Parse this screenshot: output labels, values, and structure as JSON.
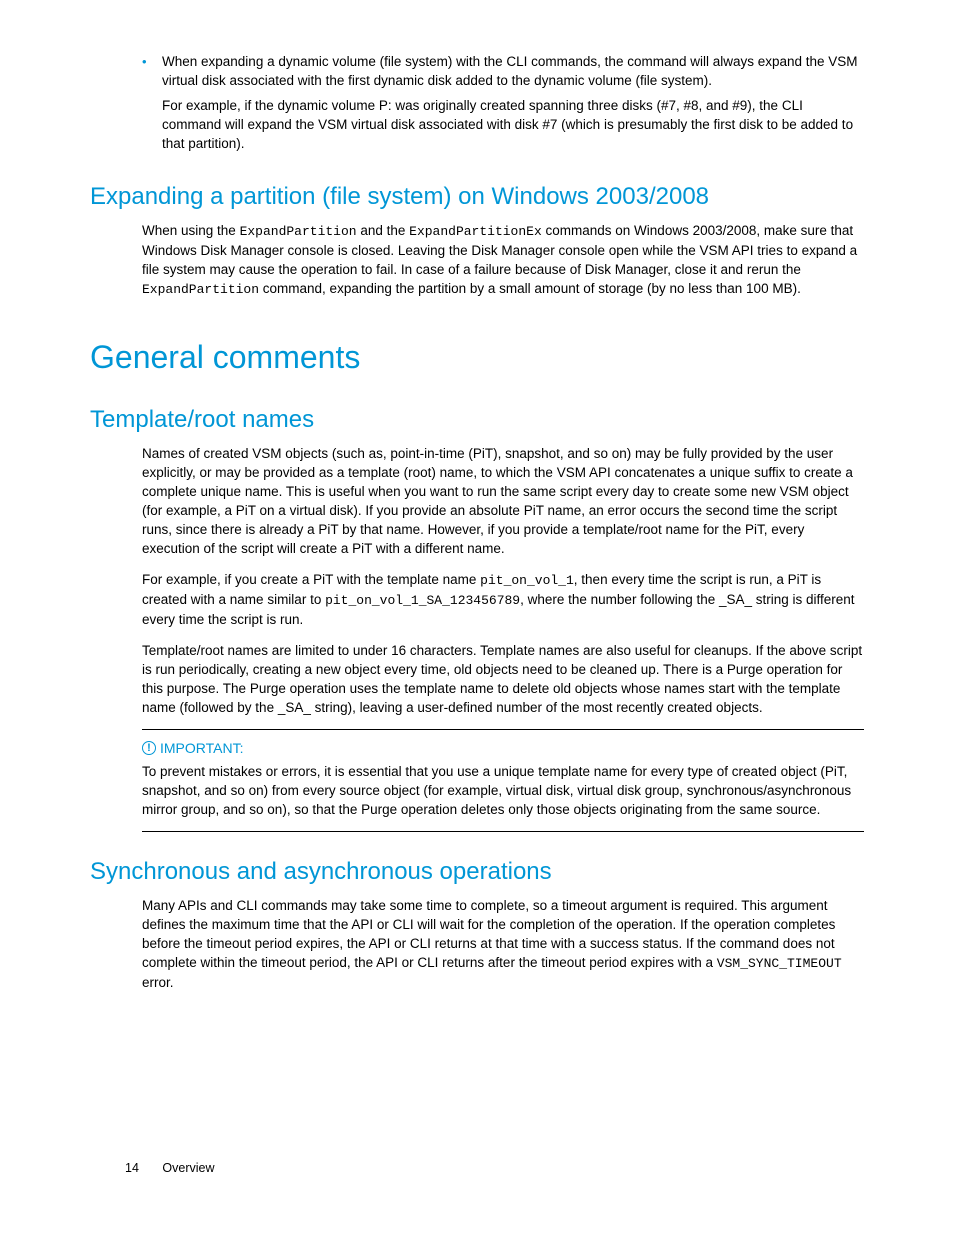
{
  "bullet": {
    "text": "When expanding a dynamic volume (file system) with the CLI commands, the command will always expand the VSM virtual disk associated with the first dynamic disk added to the dynamic volume (file system).",
    "sub": "For example, if the dynamic volume P: was originally created spanning three disks (#7, #8, and #9), the CLI command will expand the VSM virtual disk associated with disk #7 (which is presumably the first disk to be added to that partition)."
  },
  "sec_expand": {
    "heading": "Expanding a partition (file system) on Windows 2003/2008",
    "p1a": "When using the ",
    "c1": "ExpandPartition",
    "p1b": " and the ",
    "c2": "ExpandPartitionEx",
    "p1c": " commands on Windows 2003/2008, make sure that Windows Disk Manager console is closed. Leaving the Disk Manager console open while the VSM API tries to expand a file system may cause the operation to fail. In case of a failure because of Disk Manager, close it and rerun the ",
    "c3": "ExpandPartition",
    "p1d": " command, expanding the partition by a small amount of storage (by no less than 100 MB)."
  },
  "h_general": "General comments",
  "sec_template": {
    "heading": "Template/root names",
    "p1": "Names of created VSM objects (such as, point-in-time (PiT), snapshot, and so on) may be fully provided by the user explicitly, or may be provided as a template (root) name, to which the VSM API concatenates a unique suffix to create a complete unique name. This is useful when you want to run the same script every day to create some new VSM object (for example, a PiT on a virtual disk). If you provide an absolute PiT name, an error occurs the second time the script runs, since there is already a PiT by that name. However, if you provide a template/root name for the PiT, every execution of the script will create a PiT with a different name.",
    "p2a": "For example, if you create a PiT with the template name ",
    "c1": "pit_on_vol_1",
    "p2b": ", then every time the script is run, a PiT is created with a name similar to ",
    "c2": "pit_on_vol_1_SA_123456789",
    "p2c": ", where the number following the _SA_ string is different every time the script is run.",
    "p3": "Template/root names are limited to under 16 characters. Template names are also useful for cleanups. If the above script is run periodically, creating a new object every time, old objects need to be cleaned up. There is a Purge operation for this purpose. The Purge operation uses the template name to delete old objects whose names start with the template name (followed by the _SA_ string), leaving a user-defined number of the most recently created objects."
  },
  "important": {
    "label": "IMPORTANT:",
    "text": "To prevent mistakes or errors, it is essential that you use a unique template name for every type of created object (PiT, snapshot, and so on) from every source object (for example, virtual disk, virtual disk group, synchronous/asynchronous mirror group, and so on), so that the Purge operation deletes only those objects originating from the same source."
  },
  "sec_sync": {
    "heading": "Synchronous and asynchronous operations",
    "p1a": "Many APIs and CLI commands may take some time to complete, so a timeout argument is required. This argument defines the maximum time that the API or CLI will wait for the completion of the operation. If the operation completes before the timeout period expires, the API or CLI returns at that time with a success status. If the command does not complete within the timeout period, the API or CLI returns after the timeout period expires with a ",
    "c1": "VSM_SYNC_TIMEOUT",
    "p1b": " error."
  },
  "footer": {
    "page": "14",
    "section": "Overview"
  }
}
